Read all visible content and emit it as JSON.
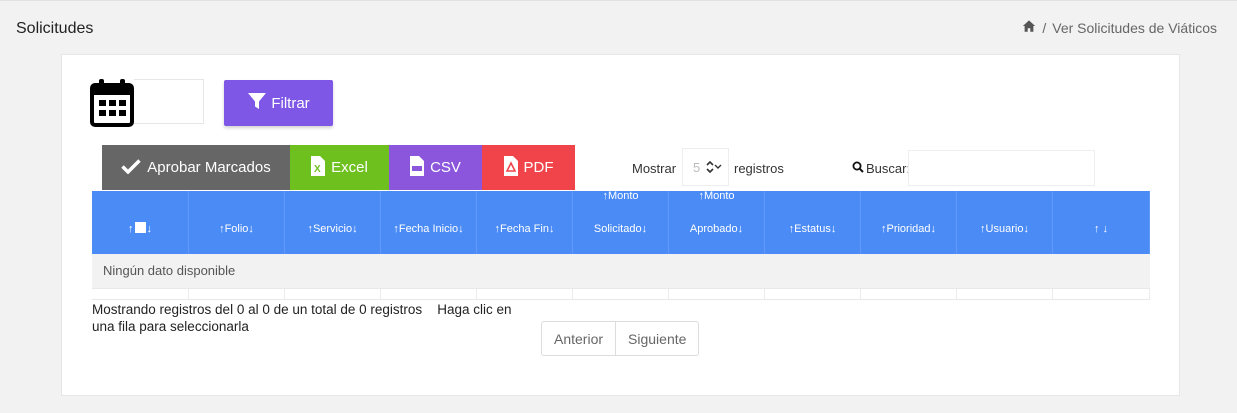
{
  "page": {
    "title": "Solicitudes",
    "breadcrumb": {
      "home_icon": "home-icon",
      "separator": "/",
      "current": "Ver Solicitudes de Viáticos"
    }
  },
  "toolbar": {
    "calendar_icon": "calendar-icon",
    "date_value": "",
    "filter_label": "Filtrar",
    "filter_icon": "funnel-icon"
  },
  "actions": {
    "approve_label": "Aprobar Marcados",
    "excel_label": "Excel",
    "csv_label": "CSV",
    "pdf_label": "PDF",
    "colors": {
      "approve": "#666666",
      "excel": "#6ec01e",
      "csv": "#8b55dc",
      "pdf": "#f0444a"
    }
  },
  "length": {
    "show_label": "Mostrar",
    "value": "5",
    "records_label": "registros"
  },
  "search": {
    "label": "Buscar:",
    "value": ""
  },
  "table": {
    "header_color": "#4b8bf5",
    "columns": [
      {
        "line1": "",
        "line2": ""
      },
      {
        "line1": "",
        "line2": "Folio"
      },
      {
        "line1": "",
        "line2": "Servicio"
      },
      {
        "line1": "",
        "line2": "Fecha Inicio"
      },
      {
        "line1": "",
        "line2": "Fecha Fin"
      },
      {
        "line1": "Monto",
        "line2": "Solicitado"
      },
      {
        "line1": "Monto",
        "line2": "Aprobado"
      },
      {
        "line1": "",
        "line2": "Estatus"
      },
      {
        "line1": "",
        "line2": "Prioridad"
      },
      {
        "line1": "",
        "line2": "Usuario"
      },
      {
        "line1": "",
        "line2": ""
      }
    ],
    "empty_message": "Ningún dato disponible"
  },
  "footer": {
    "info": "Mostrando registros del 0 al 0 de un total de 0 registros",
    "hint": "Haga clic en una fila para seleccionarla",
    "prev_label": "Anterior",
    "next_label": "Siguiente"
  }
}
